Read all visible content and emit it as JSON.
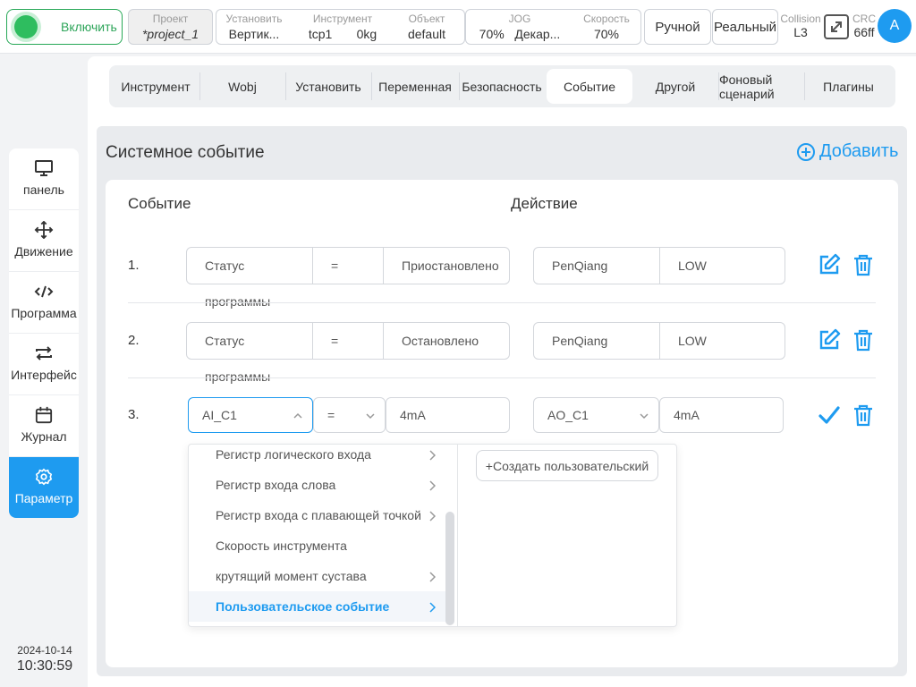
{
  "topbar": {
    "power_label": "Включить",
    "project": {
      "caption": "Проект",
      "value": "*project_1"
    },
    "install": {
      "caption": "Установить",
      "value": "Вертик..."
    },
    "tool": {
      "caption": "Инструмент",
      "value_a": "tcp1",
      "value_b": "0kg"
    },
    "object": {
      "caption": "Объект",
      "value": "default"
    },
    "jog": {
      "caption": "JOG",
      "value_a": "70%",
      "value_b": "Декар..."
    },
    "speed": {
      "caption": "Скорость",
      "value": "70%"
    },
    "mode_manual": "Ручной",
    "mode_real": "Реальный",
    "collision": {
      "caption": "Collision",
      "value": "L3"
    },
    "crc": {
      "caption": "CRC",
      "value": "66ff"
    },
    "avatar_letter": "A"
  },
  "sidebar": {
    "items": [
      {
        "label": "панель",
        "icon": "monitor-icon"
      },
      {
        "label": "Движение",
        "icon": "move-icon"
      },
      {
        "label": "Программа",
        "icon": "code-icon"
      },
      {
        "label": "Интерфейс",
        "icon": "swap-icon"
      },
      {
        "label": "Журнал",
        "icon": "calendar-icon"
      },
      {
        "label": "Параметр",
        "icon": "gear-icon"
      }
    ],
    "date": "2024-10-14",
    "time": "10:30:59"
  },
  "tabs": [
    "Инструмент",
    "Wobj",
    "Установить",
    "Переменная",
    "Безопасность",
    "Событие",
    "Другой",
    "Фоновый сценарий",
    "Плагины"
  ],
  "active_tab": "Событие",
  "panel": {
    "title": "Системное событие",
    "add_label": "Добавить",
    "col_event": "Событие",
    "col_action": "Действие"
  },
  "rows": [
    {
      "num": "1.",
      "field": "Статус",
      "op": "=",
      "value": "Приостановлено",
      "value_wrap": "программы",
      "action_target": "PenQiang",
      "action_value": "LOW"
    },
    {
      "num": "2.",
      "field": "Статус",
      "op": "=",
      "value": "Остановлено",
      "value_wrap": "программы",
      "action_target": "PenQiang",
      "action_value": "LOW"
    },
    {
      "num": "3.",
      "field": "AI_C1",
      "op": "=",
      "value": "4mA",
      "action_target": "AO_C1",
      "action_value": "4mA"
    }
  ],
  "dropdown": {
    "items": [
      {
        "label": "Регистр логического входа",
        "has_sub": true
      },
      {
        "label": "Регистр входа слова",
        "has_sub": true
      },
      {
        "label": "Регистр входа с плавающей точкой",
        "has_sub": true
      },
      {
        "label": "Скорость инструмента",
        "has_sub": false
      },
      {
        "label": "крутящий момент сустава",
        "has_sub": true
      },
      {
        "label": "Пользовательское событие",
        "has_sub": true
      }
    ],
    "create_label": "+Создать пользовательский"
  },
  "colors": {
    "accent": "#1e9bf0",
    "power_green": "#2ebd5f"
  }
}
